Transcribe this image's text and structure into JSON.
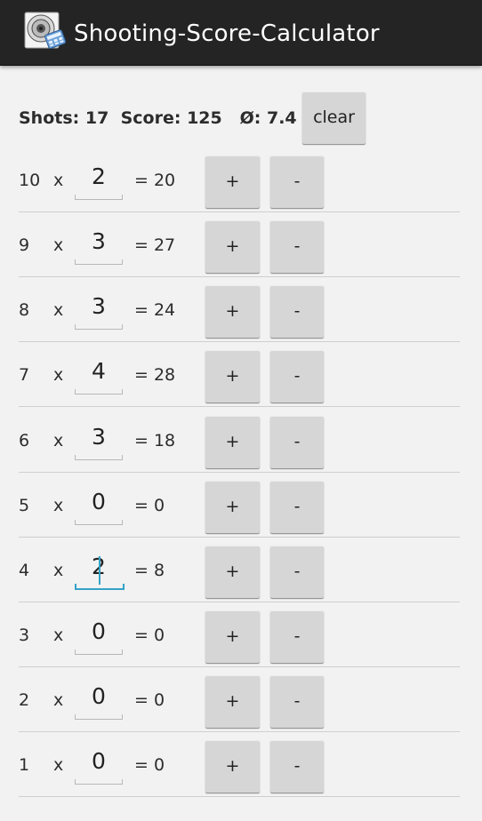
{
  "app": {
    "title": "Shooting-Score-Calculator"
  },
  "summary": {
    "shots_label": "Shots:",
    "shots": "17",
    "score_label": "Score:",
    "score": "125",
    "avg_label": "Ø:",
    "avg": "7.4",
    "clear_label": "clear"
  },
  "rows": [
    {
      "ring": "10",
      "times": "x",
      "count": "2",
      "equals": "=",
      "result": "20",
      "plus": "+",
      "minus": "-"
    },
    {
      "ring": "9",
      "times": "x",
      "count": "3",
      "equals": "=",
      "result": "27",
      "plus": "+",
      "minus": "-"
    },
    {
      "ring": "8",
      "times": "x",
      "count": "3",
      "equals": "=",
      "result": "24",
      "plus": "+",
      "minus": "-"
    },
    {
      "ring": "7",
      "times": "x",
      "count": "4",
      "equals": "=",
      "result": "28",
      "plus": "+",
      "minus": "-"
    },
    {
      "ring": "6",
      "times": "x",
      "count": "3",
      "equals": "=",
      "result": "18",
      "plus": "+",
      "minus": "-"
    },
    {
      "ring": "5",
      "times": "x",
      "count": "0",
      "equals": "=",
      "result": "0",
      "plus": "+",
      "minus": "-"
    },
    {
      "ring": "4",
      "times": "x",
      "count": "2",
      "equals": "=",
      "result": "8",
      "plus": "+",
      "minus": "-",
      "focused": true
    },
    {
      "ring": "3",
      "times": "x",
      "count": "0",
      "equals": "=",
      "result": "0",
      "plus": "+",
      "minus": "-"
    },
    {
      "ring": "2",
      "times": "x",
      "count": "0",
      "equals": "=",
      "result": "0",
      "plus": "+",
      "minus": "-"
    },
    {
      "ring": "1",
      "times": "x",
      "count": "0",
      "equals": "=",
      "result": "0",
      "plus": "+",
      "minus": "-"
    }
  ],
  "icons": {
    "app": "target-calculator-icon"
  },
  "colors": {
    "actionbar": "#242424",
    "background": "#f2f2f2",
    "button": "#d6d6d6",
    "focus": "#33a3c8"
  }
}
